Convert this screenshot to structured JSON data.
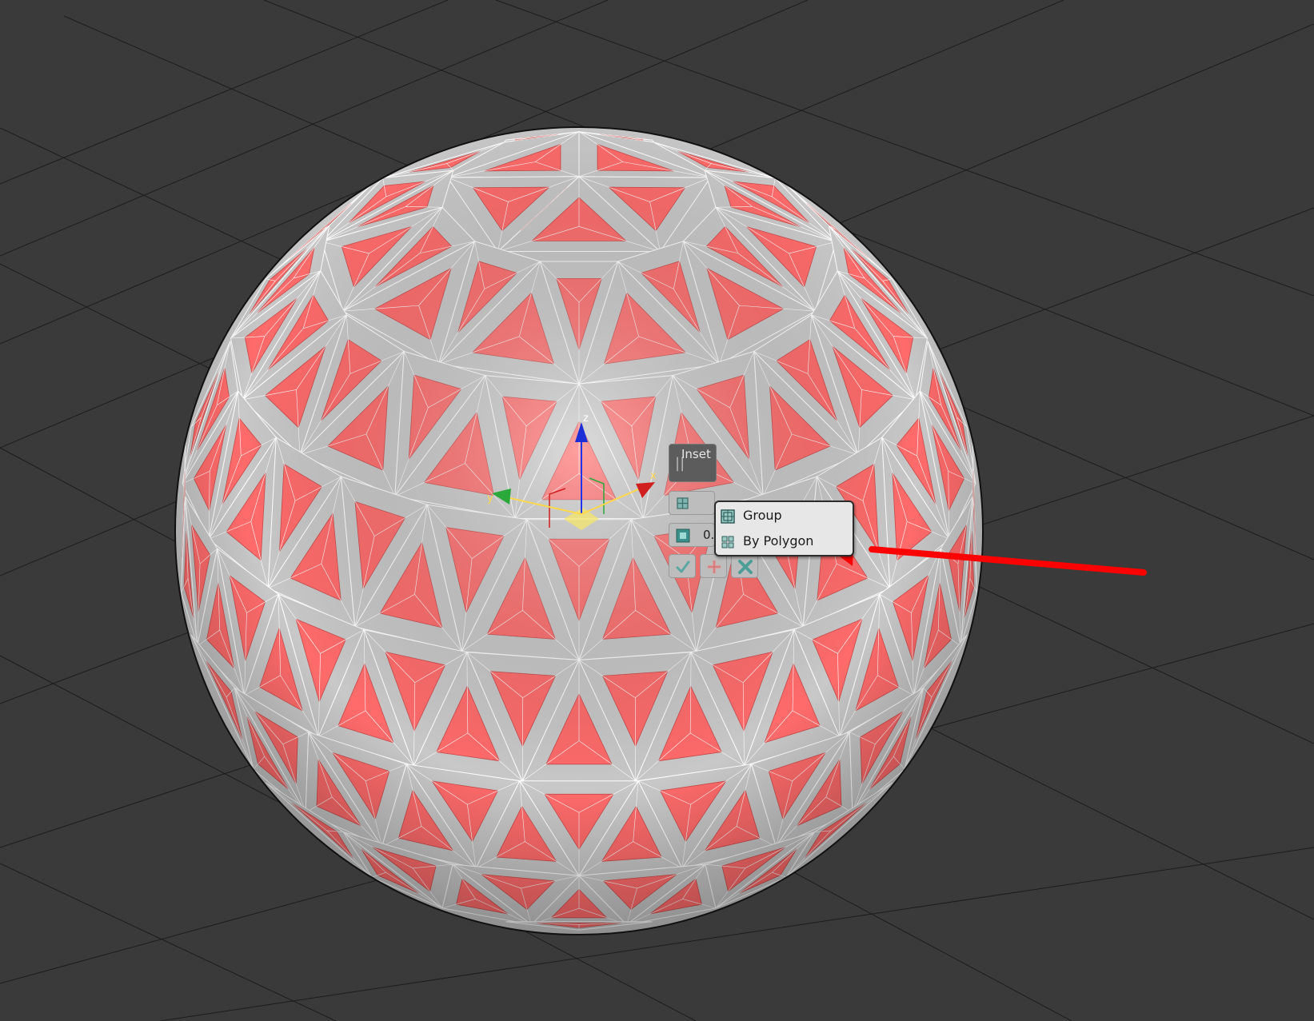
{
  "viewport": {
    "background": "#3a3a3a",
    "grid_color": "#1c1c1c",
    "object": "geodesic sphere",
    "face_color": "#ff6b6b",
    "frame_color": "#c8c8c8",
    "wire_color": "#ffffff"
  },
  "gizmo": {
    "axis_x": "x",
    "axis_y": "y",
    "axis_z": "z",
    "x_color": "#d11e1e",
    "y_color": "#2aa83a",
    "z_color": "#1c2fd6",
    "plane_color": "#f5e56b"
  },
  "caddy": {
    "title": "Inset",
    "grip_glyph": "||",
    "inset_type_icon": "inset-type-icon",
    "amount_value": "0.",
    "ok_icon": "checkmark-icon",
    "apply_icon": "plus-icon",
    "cancel_icon": "close-icon"
  },
  "dropdown": {
    "items": [
      {
        "label": "Group",
        "icon": "group-icon"
      },
      {
        "label": "By Polygon",
        "icon": "by-polygon-icon"
      }
    ]
  },
  "annotation": {
    "arrow_color": "#ff0000"
  }
}
